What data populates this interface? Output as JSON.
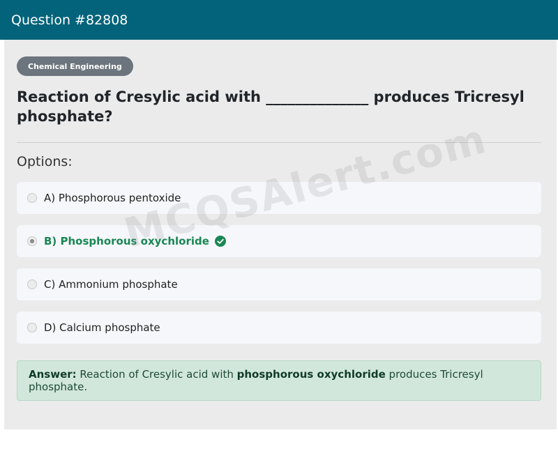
{
  "header": {
    "title": "Question #82808"
  },
  "category": "Chemical Engineering",
  "question": "Reaction of Cresylic acid with ______________ produces Tricresyl phosphate?",
  "options_label": "Options:",
  "options": [
    {
      "label": "A) Phosphorous pentoxide",
      "selected": false,
      "correct": false
    },
    {
      "label": "B) Phosphorous oxychloride",
      "selected": true,
      "correct": true
    },
    {
      "label": "C) Ammonium phosphate",
      "selected": false,
      "correct": false
    },
    {
      "label": "D) Calcium phosphate",
      "selected": false,
      "correct": false
    }
  ],
  "answer": {
    "prefix": "Answer:",
    "text_before": " Reaction of Cresylic acid with ",
    "highlight": "phosphorous oxychloride",
    "text_after": " produces Tricresyl phosphate."
  },
  "watermark": "MCQSAlert.com",
  "colors": {
    "header": "#02637a",
    "correct": "#198754",
    "badge": "#6c757d",
    "answer_bg": "#d2e7dc"
  }
}
